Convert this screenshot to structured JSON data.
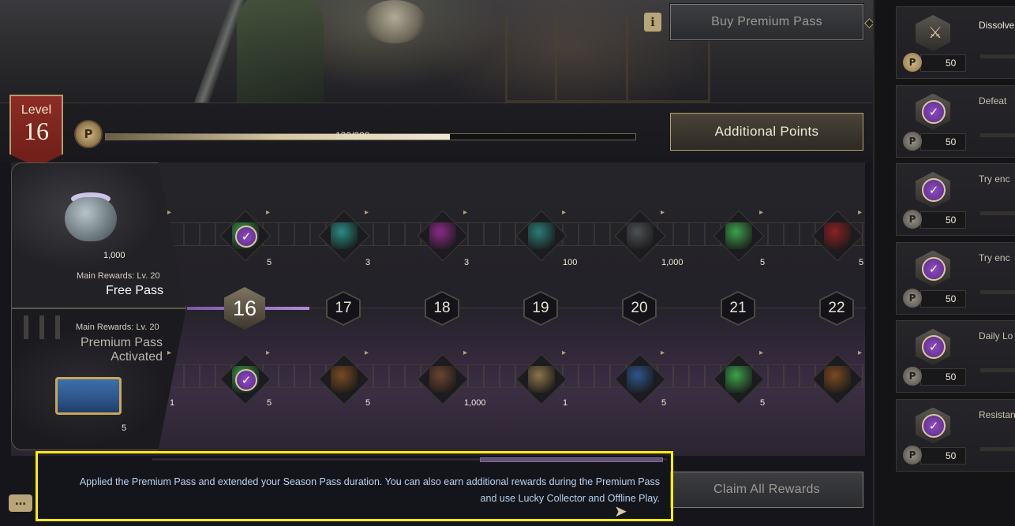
{
  "header": {
    "buy_premium_label": "Buy Premium Pass",
    "additional_points_label": "Additional Points",
    "claim_all_label": "Claim All Rewards",
    "quest_icon": "scroll-icon",
    "quest_glyph": "i"
  },
  "level": {
    "label": "Level",
    "value": "16",
    "points_icon_glyph": "P",
    "progress_text": "130/200",
    "progress_fraction": 0.65
  },
  "free_pass": {
    "reward_qty": "1,000",
    "main_rewards": "Main Rewards: Lv. 20",
    "title": "Free Pass",
    "items": [
      {
        "icon": "crystal-vial-icon",
        "qty": "5",
        "claimed": true,
        "color": "#3ca24a"
      },
      {
        "icon": "teal-feather-icon",
        "qty": "3",
        "claimed": false,
        "color": "#2a8c84"
      },
      {
        "icon": "purple-feather-icon",
        "qty": "3",
        "claimed": false,
        "color": "#8a2a88"
      },
      {
        "icon": "monstera-leaf-icon",
        "qty": "100",
        "claimed": false,
        "color": "#2a7c78"
      },
      {
        "icon": "coin-pouch-icon",
        "qty": "1,000",
        "claimed": false,
        "color": "#4c5054"
      },
      {
        "icon": "potion-vial-icon",
        "qty": "5",
        "claimed": false,
        "color": "#3ca24a"
      },
      {
        "icon": "pomegranate-icon",
        "qty": "5",
        "claimed": false,
        "color": "#8c2024"
      }
    ]
  },
  "premium_pass": {
    "main_rewards": "Main Rewards: Lv. 20",
    "title_line1": "Premium Pass",
    "title_line2": "Activated",
    "reward_qty": "5",
    "edge_qty": "1",
    "items": [
      {
        "icon": "potion-vial-icon",
        "qty": "5",
        "claimed": true,
        "color": "#3ca24a"
      },
      {
        "icon": "treasure-chest-icon",
        "qty": "5",
        "claimed": false,
        "color": "#7a4a24"
      },
      {
        "icon": "green-pouch-icon",
        "qty": "1,000",
        "claimed": false,
        "color": "#6a4430"
      },
      {
        "icon": "bronze-coin-icon",
        "qty": "1",
        "claimed": false,
        "color": "#8a7448"
      },
      {
        "icon": "blue-chest-icon",
        "qty": "5",
        "claimed": false,
        "color": "#2d558a"
      },
      {
        "icon": "potion-vial-icon",
        "qty": "5",
        "claimed": false,
        "color": "#3ca24a"
      },
      {
        "icon": "treasure-chest-icon",
        "qty": "",
        "claimed": false,
        "color": "#7a4a24"
      }
    ]
  },
  "levels": [
    "16",
    "17",
    "18",
    "19",
    "20",
    "21",
    "22"
  ],
  "current_level_index": 0,
  "missions": [
    {
      "text": "Dissolve",
      "points": "50",
      "icon": "sword-crest-icon",
      "completed": false,
      "gold_points": true
    },
    {
      "text": "Defeat",
      "points": "50",
      "icon": "check-badge-icon",
      "completed": true,
      "gold_points": false
    },
    {
      "text": "Try enc",
      "points": "50",
      "icon": "check-badge-icon",
      "completed": true,
      "gold_points": false
    },
    {
      "text": "Try enc",
      "points": "50",
      "icon": "check-badge-icon",
      "completed": true,
      "gold_points": false
    },
    {
      "text": "Daily Lo",
      "points": "50",
      "icon": "check-badge-icon",
      "completed": true,
      "gold_points": false
    },
    {
      "text": "Resistan",
      "points": "50",
      "icon": "check-badge-icon",
      "completed": true,
      "gold_points": false
    }
  ],
  "notice": {
    "line1": "Applied the Premium Pass and extended your Season Pass duration. You can also earn additional rewards during the Premium Pass",
    "line2": "and use Lucky Collector and Offline Play."
  },
  "icons": {
    "chat": "chat-bubble-icon",
    "chat_glyph": "…",
    "check_glyph": "✓",
    "mission_points_glyph": "P",
    "crest_glyph": "⚔",
    "cursor_glyph": "➤",
    "arrow_glyph": "▸"
  },
  "colors": {
    "accent_gold": "#b8a374",
    "level_badge": "#8c2c24",
    "check_purple": "#8d4cc0",
    "notice_border": "#ffee00",
    "notice_text": "#b9d4f0"
  }
}
